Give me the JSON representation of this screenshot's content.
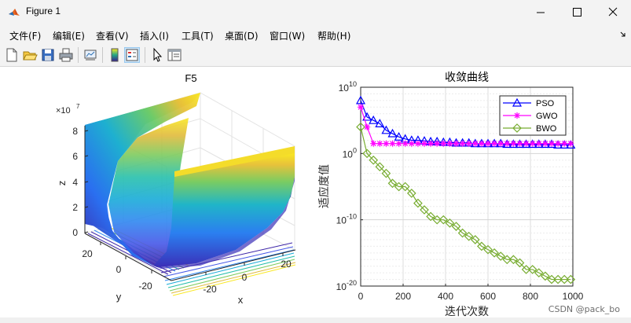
{
  "window": {
    "title": "Figure 1"
  },
  "menu": [
    {
      "label": "文件(F)"
    },
    {
      "label": "编辑(E)"
    },
    {
      "label": "查看(V)"
    },
    {
      "label": "插入(I)"
    },
    {
      "label": "工具(T)"
    },
    {
      "label": "桌面(D)"
    },
    {
      "label": "窗口(W)"
    },
    {
      "label": "帮助(H)"
    }
  ],
  "toolbar_icons": [
    "new-figure-icon",
    "open-file-icon",
    "save-icon",
    "print-icon",
    "link-plot-icon",
    "colorbar-icon",
    "legend-icon",
    "pointer-icon",
    "property-inspector-icon"
  ],
  "surface_plot": {
    "title": "F5",
    "exponent_label": "×10",
    "exponent": "7",
    "zlabel": "z",
    "ylabel": "y",
    "xlabel": "x",
    "z_ticks": [
      "8",
      "6",
      "4",
      "2",
      "0"
    ],
    "y_ticks": [
      "20",
      "0",
      "-20"
    ],
    "x_ticks": [
      "-20",
      "0",
      "20"
    ]
  },
  "chart_data": {
    "type": "line",
    "title": "收敛曲线",
    "xlabel": "迭代次数",
    "ylabel": "适应度值",
    "yscale": "log",
    "xlim": [
      0,
      1000
    ],
    "ylim": [
      1e-20,
      10000000000.0
    ],
    "x_ticks": [
      "0",
      "200",
      "400",
      "600",
      "800",
      "1000"
    ],
    "y_ticks": [
      {
        "base": "10",
        "exp": "10"
      },
      {
        "base": "10",
        "exp": "0"
      },
      {
        "base": "10",
        "exp": "-10"
      },
      {
        "base": "10",
        "exp": "-20"
      }
    ],
    "grid": true,
    "legend_position": "top-right",
    "x": [
      0,
      30,
      60,
      90,
      120,
      150,
      180,
      210,
      240,
      270,
      300,
      330,
      360,
      390,
      420,
      450,
      480,
      510,
      540,
      570,
      600,
      630,
      660,
      690,
      720,
      750,
      780,
      810,
      840,
      870,
      900,
      930,
      960,
      990
    ],
    "series": [
      {
        "name": "PSO",
        "color": "#0000ff",
        "marker": "triangle",
        "log10_values": [
          8,
          5.5,
          5,
          4.5,
          3.5,
          3,
          2.5,
          2.2,
          2,
          2,
          1.9,
          1.8,
          1.8,
          1.7,
          1.7,
          1.6,
          1.6,
          1.6,
          1.5,
          1.5,
          1.5,
          1.5,
          1.5,
          1.4,
          1.4,
          1.4,
          1.4,
          1.4,
          1.4,
          1.4,
          1.4,
          1.3,
          1.3,
          1.3
        ]
      },
      {
        "name": "GWO",
        "color": "#ff00ff",
        "marker": "star",
        "log10_values": [
          7,
          4,
          1.5,
          1.5,
          1.5,
          1.5,
          1.5,
          1.5,
          1.5,
          1.5,
          1.5,
          1.5,
          1.5,
          1.5,
          1.5,
          1.5,
          1.5,
          1.5,
          1.5,
          1.5,
          1.5,
          1.5,
          1.5,
          1.5,
          1.5,
          1.5,
          1.5,
          1.5,
          1.5,
          1.5,
          1.5,
          1.5,
          1.5,
          1.5
        ]
      },
      {
        "name": "BWO",
        "color": "#77ac30",
        "marker": "diamond",
        "log10_values": [
          4,
          0,
          -1,
          -2,
          -3,
          -4.5,
          -5,
          -5,
          -6,
          -7.5,
          -8.5,
          -9.5,
          -10,
          -10,
          -10.5,
          -11,
          -12,
          -12.5,
          -13,
          -14,
          -14.5,
          -15,
          -15.5,
          -16,
          -16,
          -16.5,
          -17.5,
          -17.5,
          -18,
          -18.5,
          -19,
          -19,
          -19,
          -19
        ]
      }
    ]
  },
  "watermark": "CSDN @pack_bo"
}
